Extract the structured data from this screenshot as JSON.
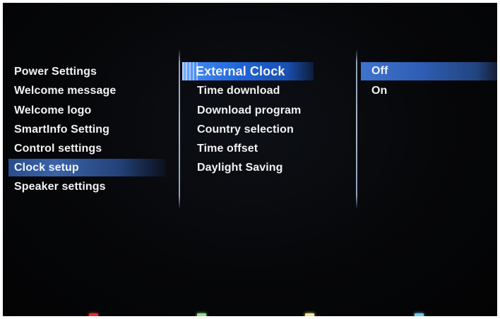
{
  "left_menu": {
    "items": [
      {
        "label": "Power Settings"
      },
      {
        "label": "Welcome message"
      },
      {
        "label": "Welcome logo"
      },
      {
        "label": "SmartInfo Setting"
      },
      {
        "label": "Control settings"
      },
      {
        "label": "Clock setup",
        "selected": true
      },
      {
        "label": "Speaker settings"
      }
    ]
  },
  "middle_menu": {
    "items": [
      {
        "label": "External Clock",
        "focused": true
      },
      {
        "label": "Time download"
      },
      {
        "label": "Download program"
      },
      {
        "label": "Country selection"
      },
      {
        "label": "Time offset"
      },
      {
        "label": "Daylight Saving"
      }
    ]
  },
  "right_menu": {
    "items": [
      {
        "label": "Off",
        "selected": true
      },
      {
        "label": "On"
      }
    ]
  },
  "color_keys": [
    {
      "name": "red",
      "color": "#e0303a"
    },
    {
      "name": "green",
      "color": "#8fe08a"
    },
    {
      "name": "yellow",
      "color": "#f0e6a0"
    },
    {
      "name": "blue",
      "color": "#6cc8f0"
    }
  ],
  "colors": {
    "background": "#050608",
    "text": "#f2f2f2",
    "highlight": "#1f64d8"
  }
}
